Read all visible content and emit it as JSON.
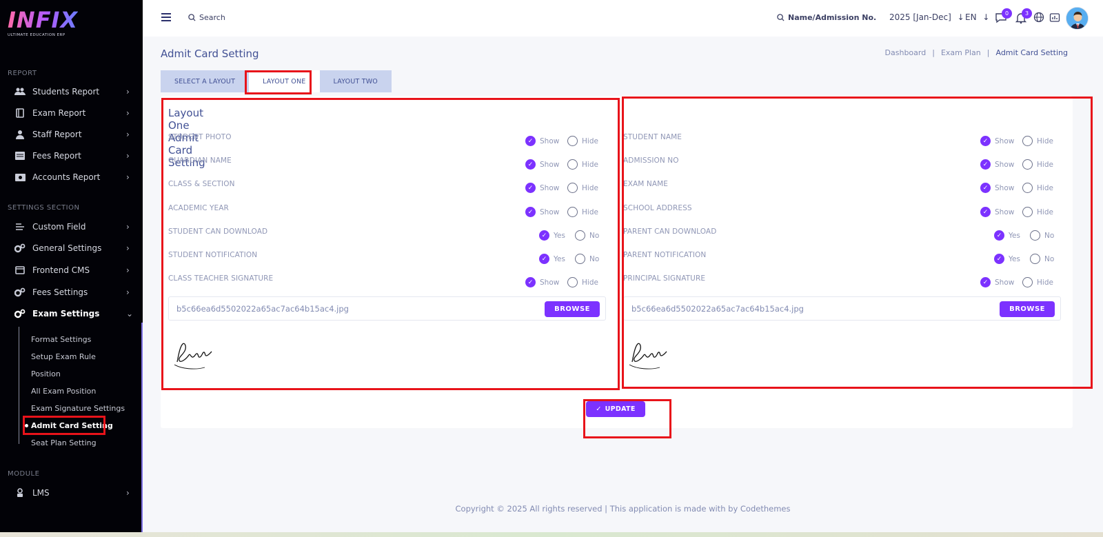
{
  "app": {
    "logo_text": "INFIX",
    "logo_subtitle": "ULTIMATE EDUCATION ERP"
  },
  "sidebar": {
    "report_title": "REPORT",
    "report_items": [
      {
        "label": "Students Report",
        "icon": "users-icon"
      },
      {
        "label": "Exam Report",
        "icon": "book-icon"
      },
      {
        "label": "Staff Report",
        "icon": "user-tie-icon"
      },
      {
        "label": "Fees Report",
        "icon": "receipt-icon"
      },
      {
        "label": "Accounts Report",
        "icon": "money-icon"
      }
    ],
    "settings_title": "SETTINGS SECTION",
    "settings_items": [
      {
        "label": "Custom Field",
        "icon": "custom-field-icon"
      },
      {
        "label": "General Settings",
        "icon": "gears-icon"
      },
      {
        "label": "Frontend CMS",
        "icon": "cms-icon"
      },
      {
        "label": "Fees Settings",
        "icon": "gears-icon"
      },
      {
        "label": "Exam Settings",
        "icon": "gears-icon"
      }
    ],
    "exam_sub_items": [
      "Format Settings",
      "Setup Exam Rule",
      "Position",
      "All Exam Position",
      "Exam Signature Settings",
      "Admit Card Setting",
      "Seat Plan Setting"
    ],
    "module_title": "MODULE",
    "module_items": [
      {
        "label": "LMS",
        "icon": "lms-icon"
      }
    ]
  },
  "header": {
    "search_label": "Search",
    "admission_search_label": "Name/Admission No.",
    "year_label": "2025 [Jan-Dec]",
    "lang_label": "EN",
    "messages_count": "0",
    "notifications_count": "3"
  },
  "page": {
    "title": "Admit Card Setting",
    "breadcrumb": [
      "Dashboard",
      "Exam Plan",
      "Admit Card Setting"
    ],
    "tabs": [
      "SELECT A LAYOUT",
      "LAYOUT ONE",
      "LAYOUT TWO"
    ],
    "active_tab": "LAYOUT ONE"
  },
  "left_panel": {
    "title": "Layout One Admit Card Setting",
    "options": [
      {
        "label": "STUDENT PHOTO",
        "on": "Show",
        "off": "Hide",
        "value": "on"
      },
      {
        "label": "GUARDIAN NAME",
        "on": "Show",
        "off": "Hide",
        "value": "on"
      },
      {
        "label": "CLASS & SECTION",
        "on": "Show",
        "off": "Hide",
        "value": "on"
      },
      {
        "label": "ACADEMIC YEAR",
        "on": "Show",
        "off": "Hide",
        "value": "on"
      },
      {
        "label": "STUDENT CAN DOWNLOAD",
        "on": "Yes",
        "off": "No",
        "value": "on"
      },
      {
        "label": "STUDENT NOTIFICATION",
        "on": "Yes",
        "off": "No",
        "value": "on"
      },
      {
        "label": "CLASS TEACHER SIGNATURE",
        "on": "Show",
        "off": "Hide",
        "value": "on"
      }
    ],
    "file_name": "b5c66ea6d5502022a65ac7ac64b15ac4.jpg",
    "browse_label": "BROWSE"
  },
  "right_panel": {
    "options": [
      {
        "label": "STUDENT NAME",
        "on": "Show",
        "off": "Hide",
        "value": "on"
      },
      {
        "label": "ADMISSION NO",
        "on": "Show",
        "off": "Hide",
        "value": "on"
      },
      {
        "label": "EXAM NAME",
        "on": "Show",
        "off": "Hide",
        "value": "on"
      },
      {
        "label": "SCHOOL ADDRESS",
        "on": "Show",
        "off": "Hide",
        "value": "on"
      },
      {
        "label": "PARENT CAN DOWNLOAD",
        "on": "Yes",
        "off": "No",
        "value": "on"
      },
      {
        "label": "PARENT NOTIFICATION",
        "on": "Yes",
        "off": "No",
        "value": "on"
      },
      {
        "label": "PRINCIPAL SIGNATURE",
        "on": "Show",
        "off": "Hide",
        "value": "on"
      }
    ],
    "file_name": "b5c66ea6d5502022a65ac7ac64b15ac4.jpg",
    "browse_label": "BROWSE"
  },
  "actions": {
    "update_label": "UPDATE"
  },
  "footer": {
    "text": "Copyright © 2025 All rights reserved | This application is made with by Codethemes"
  },
  "colors": {
    "accent": "#7c32ff",
    "highlight": "#e8131a",
    "sidebar_bg": "#020207"
  }
}
